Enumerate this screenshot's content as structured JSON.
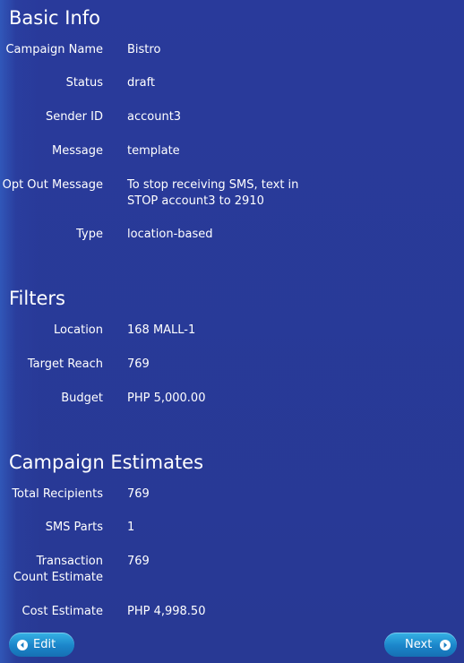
{
  "basic_info": {
    "title": "Basic Info",
    "rows": [
      {
        "label": "Campaign Name",
        "value": "Bistro"
      },
      {
        "label": "Status",
        "value": "draft"
      },
      {
        "label": "Sender ID",
        "value": "account3"
      },
      {
        "label": "Message",
        "value": "template"
      },
      {
        "label": "Opt Out Message",
        "value_line1": "To stop receiving SMS, text in",
        "value_line2": "STOP account3 to 2910"
      },
      {
        "label": "Type",
        "value": "location-based"
      }
    ]
  },
  "filters": {
    "title": "Filters",
    "rows": [
      {
        "label": "Location",
        "value": "168 MALL-1"
      },
      {
        "label": "Target Reach",
        "value": "769"
      },
      {
        "label": "Budget",
        "value": "PHP 5,000.00"
      }
    ]
  },
  "estimates": {
    "title": "Campaign Estimates",
    "rows": [
      {
        "label": "Total Recipients",
        "value": "769"
      },
      {
        "label": "SMS Parts",
        "value": "1"
      },
      {
        "label_line1": "Transaction",
        "label_line2": "Count Estimate",
        "value": "769"
      },
      {
        "label": "Cost Estimate",
        "value": "PHP 4,998.50"
      }
    ]
  },
  "actions": {
    "edit_label": "Edit",
    "edit_icon": "arrow-left-circle-icon",
    "next_label": "Next",
    "next_icon": "arrow-right-circle-icon"
  },
  "colors": {
    "background": "#283a9a",
    "button": "#1b85c9",
    "text": "#ffffff"
  }
}
